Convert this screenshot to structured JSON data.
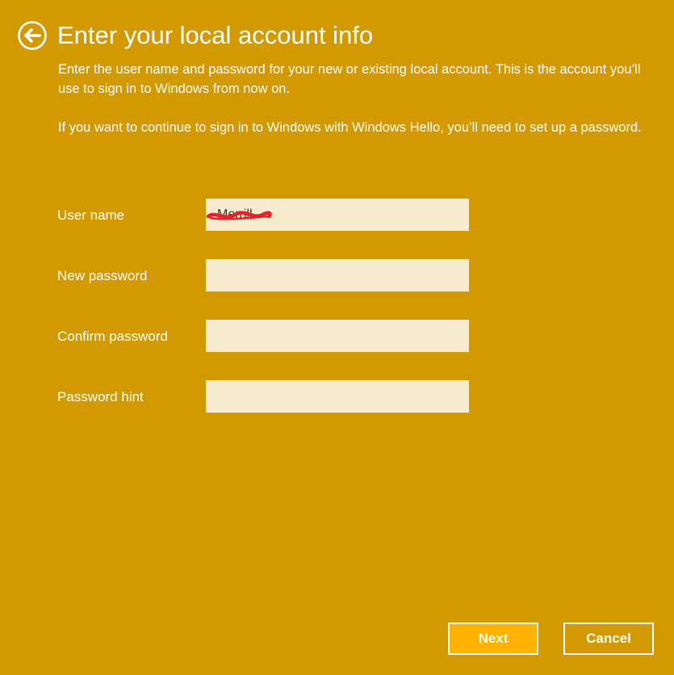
{
  "header": {
    "back_icon": "back-arrow-circle-icon",
    "title": "Enter your local account info"
  },
  "description": {
    "paragraph_1": "Enter the user name and password for your new or existing local account. This is the account you’ll use to sign in to Windows from now on.",
    "paragraph_2": "If you want to continue to sign in to Windows with Windows Hello, you’ll need to set up a password."
  },
  "form": {
    "username": {
      "label": "User name",
      "value": "Merrill"
    },
    "new_password": {
      "label": "New password",
      "value": ""
    },
    "confirm_password": {
      "label": "Confirm password",
      "value": ""
    },
    "password_hint": {
      "label": "Password hint",
      "value": ""
    }
  },
  "buttons": {
    "next_label": "Next",
    "cancel_label": "Cancel"
  },
  "colors": {
    "background": "#D29A00",
    "input_background": "#F7EBCD",
    "next_button": "#FFB300",
    "redaction_mark": "#E8202A"
  }
}
